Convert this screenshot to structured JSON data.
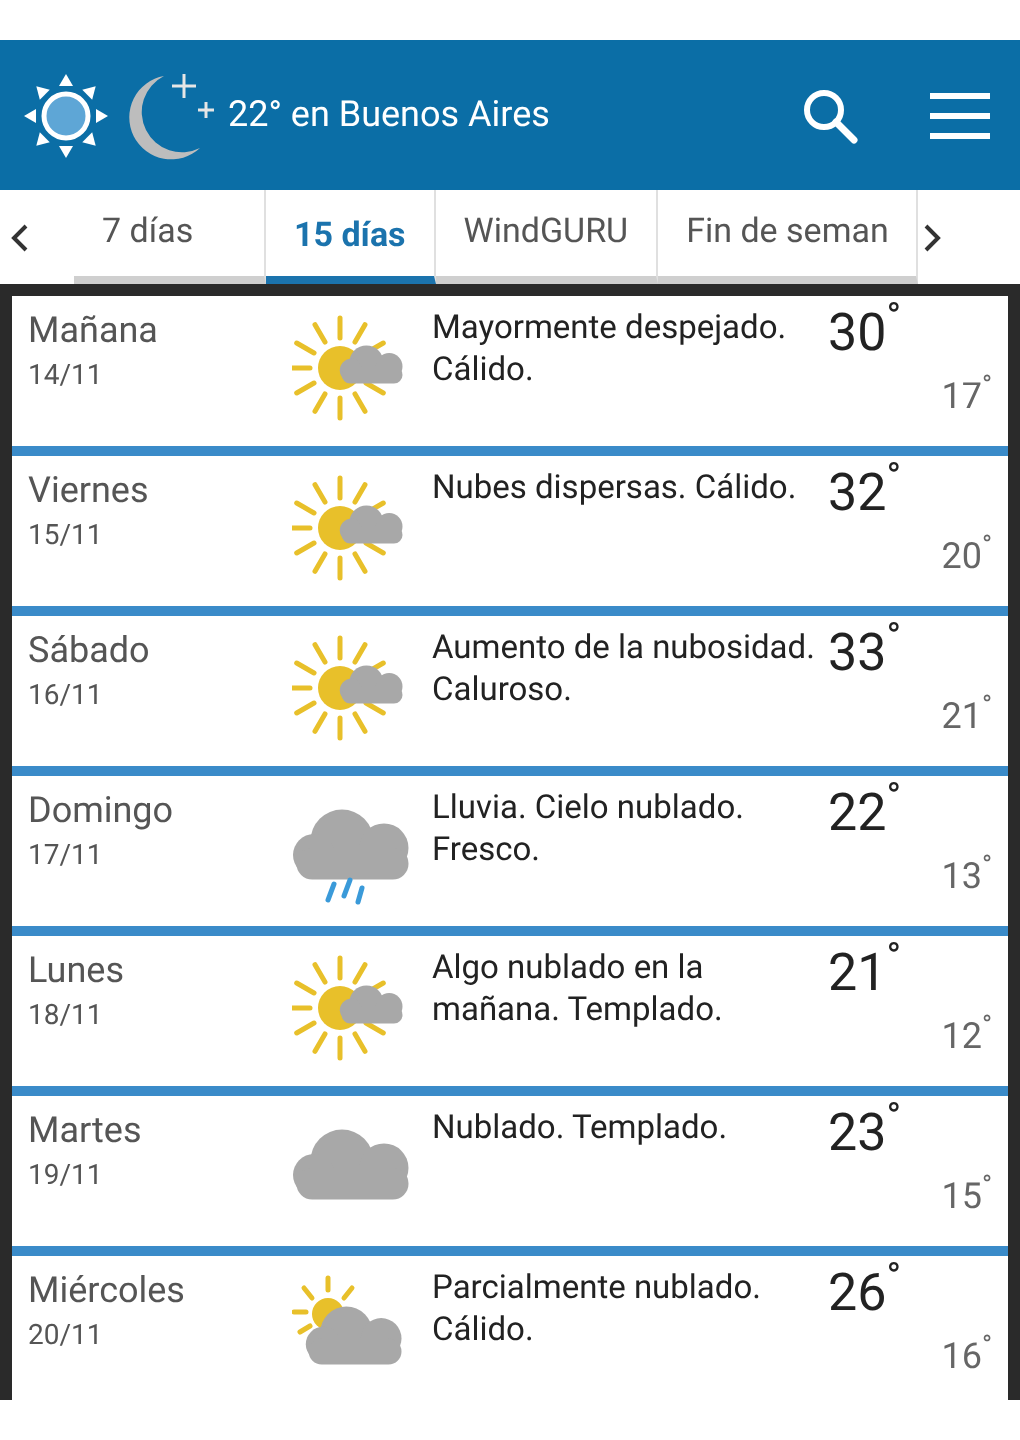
{
  "header": {
    "title": "22° en Buenos Aires"
  },
  "tabs": [
    {
      "label": "7 días",
      "selected": false
    },
    {
      "label": "15 días",
      "selected": true
    },
    {
      "label": "WindGURU",
      "selected": false
    },
    {
      "label": "Fin de seman",
      "selected": false
    }
  ],
  "days": [
    {
      "day": "Mañana",
      "date": "14/11",
      "kind": "sun_cloud",
      "summary": "Mayormente despejado. Cálido.",
      "high": "30$^{°}$",
      "low": "17$^{°}$"
    },
    {
      "day": "Viernes",
      "date": "15/11",
      "kind": "sun_cloud",
      "summary": "Nubes dispersas. Cálido.",
      "high": "32$^{°}$",
      "low": "20$^{°}$"
    },
    {
      "day": "Sábado",
      "date": "16/11",
      "kind": "sun_cloud",
      "summary": "Aumento de la nubosidad. Caluroso.",
      "high": "33$^{°}$",
      "low": "21$^{°}$"
    },
    {
      "day": "Domingo",
      "date": "17/11",
      "kind": "rain",
      "summary": "Lluvia. Cielo nublado. Fresco.",
      "high": "22$^{°}$",
      "low": "13$^{°}$"
    },
    {
      "day": "Lunes",
      "date": "18/11",
      "kind": "sun_cloud",
      "summary": "Algo nublado en la mañana. Templado.",
      "high": "21$^{°}$",
      "low": "12$^{°}$"
    },
    {
      "day": "Martes",
      "date": "19/11",
      "kind": "cloud",
      "summary": "Nublado. Templado.",
      "high": "23$^{°}$",
      "low": "15$^{°}$"
    },
    {
      "day": "Miércoles",
      "date": "20/11",
      "kind": "partly",
      "summary": "Parcialmente nublado. Cálido.",
      "high": "26$^{°}$",
      "low": "16$^{°}$"
    }
  ]
}
